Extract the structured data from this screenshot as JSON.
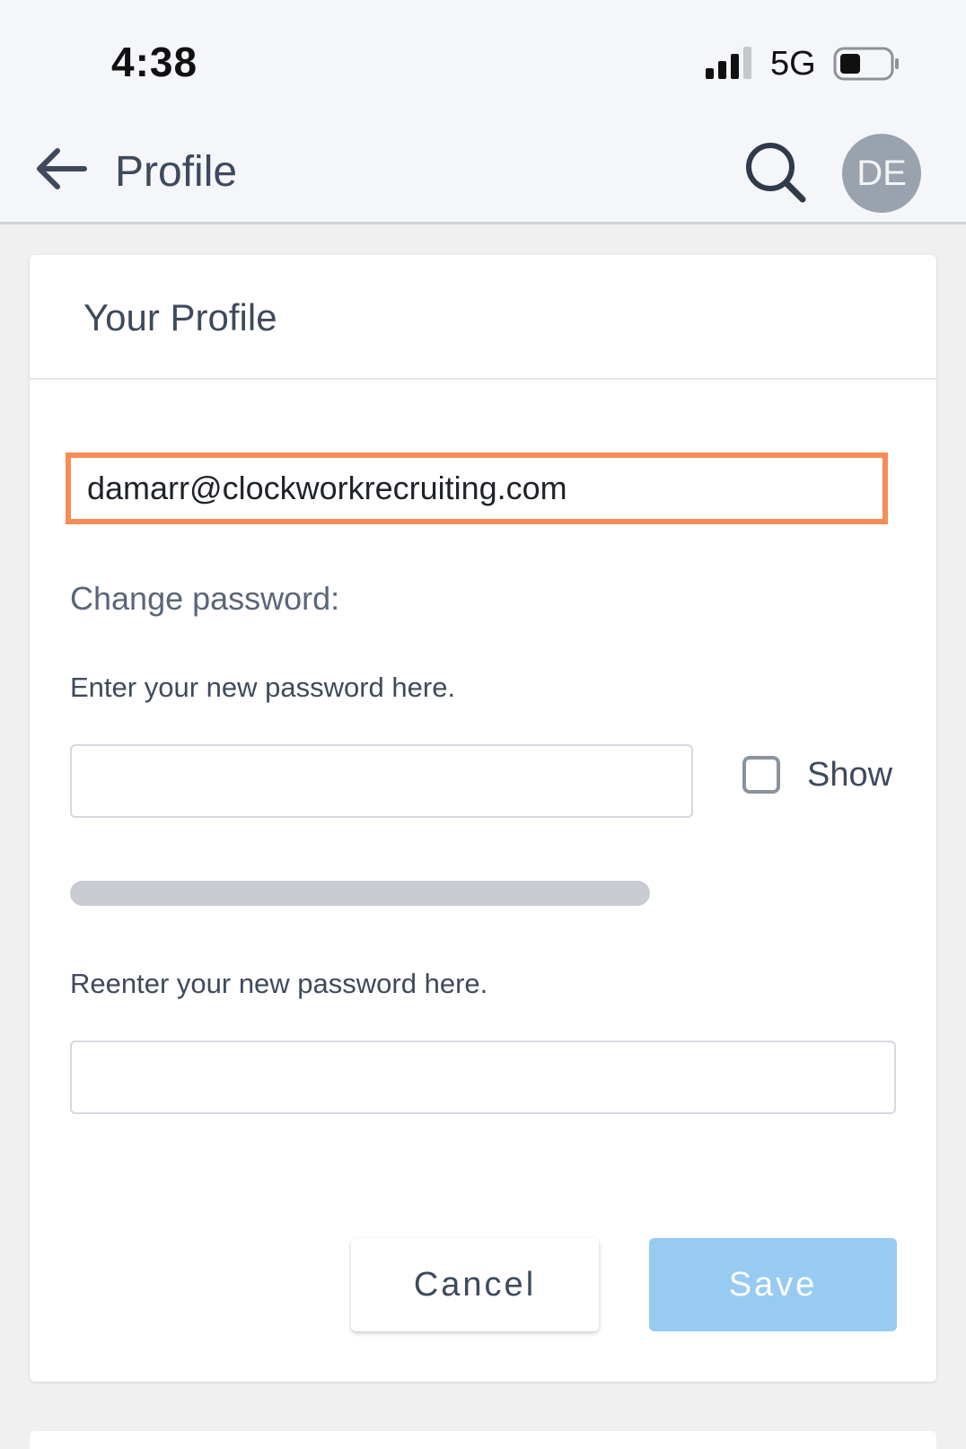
{
  "status_bar": {
    "time": "4:38",
    "network": "5G",
    "icons": [
      "cellular-signal-icon",
      "battery-icon"
    ]
  },
  "header": {
    "title": "Profile",
    "avatar_initials": "DE",
    "icons": [
      "arrow-left-icon",
      "search-icon"
    ]
  },
  "profile_card": {
    "title": "Your Profile",
    "email_value": "damarr@clockworkrecruiting.com",
    "change_password_label": "Change password:",
    "new_password_label": "Enter your new password here.",
    "new_password_value": "",
    "show_label": "Show",
    "show_checked": false,
    "password_strength": 0,
    "reenter_password_label": "Reenter your new password here.",
    "reenter_password_value": "",
    "cancel_label": "Cancel",
    "save_label": "Save"
  },
  "colors": {
    "focus_border": "#f78c55",
    "save_button": "#97cbf2",
    "avatar_bg": "#9aa2ad",
    "text_primary": "#3e4a5c",
    "strength_track": "#c9ccd2"
  }
}
